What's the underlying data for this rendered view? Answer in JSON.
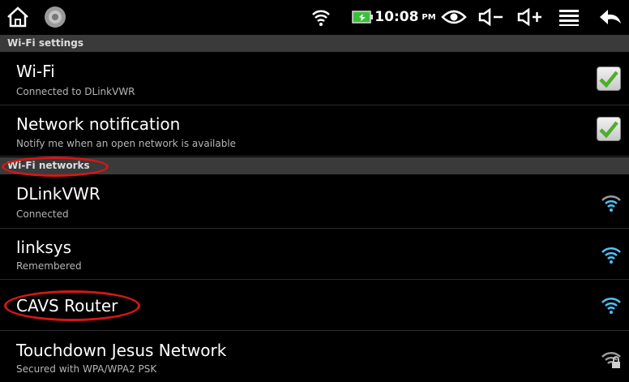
{
  "status_bar": {
    "time": "10:08",
    "ampm": "PM",
    "colors": {
      "icon": "#ffffff",
      "battery": "#3bbf3b"
    }
  },
  "wifi_settings": {
    "header": "Wi-Fi settings",
    "items": [
      {
        "title": "Wi-Fi",
        "subtitle": "Connected to DLinkVWR",
        "checked": true
      },
      {
        "title": "Network notification",
        "subtitle": "Notify me when an open network is available",
        "checked": true
      }
    ]
  },
  "wifi_networks": {
    "header": "Wi-Fi networks",
    "items": [
      {
        "name": "DLinkVWR",
        "status": "Connected",
        "icon": "wifi-signal-icon",
        "signal_color": "#c9c9c9"
      },
      {
        "name": "linksys",
        "status": "Remembered",
        "icon": "wifi-signal-icon",
        "signal_color": "#4fc3f7"
      },
      {
        "name": "CAVS Router",
        "status": "",
        "icon": "wifi-signal-icon",
        "signal_color": "#4fc3f7"
      },
      {
        "name": "Touchdown Jesus Network",
        "status": "Secured with WPA/WPA2 PSK",
        "icon": "wifi-lock-icon",
        "signal_color": "#c9c9c9"
      }
    ]
  },
  "colors": {
    "accent_check": "#4caf2a",
    "annotation": "#d81616"
  }
}
